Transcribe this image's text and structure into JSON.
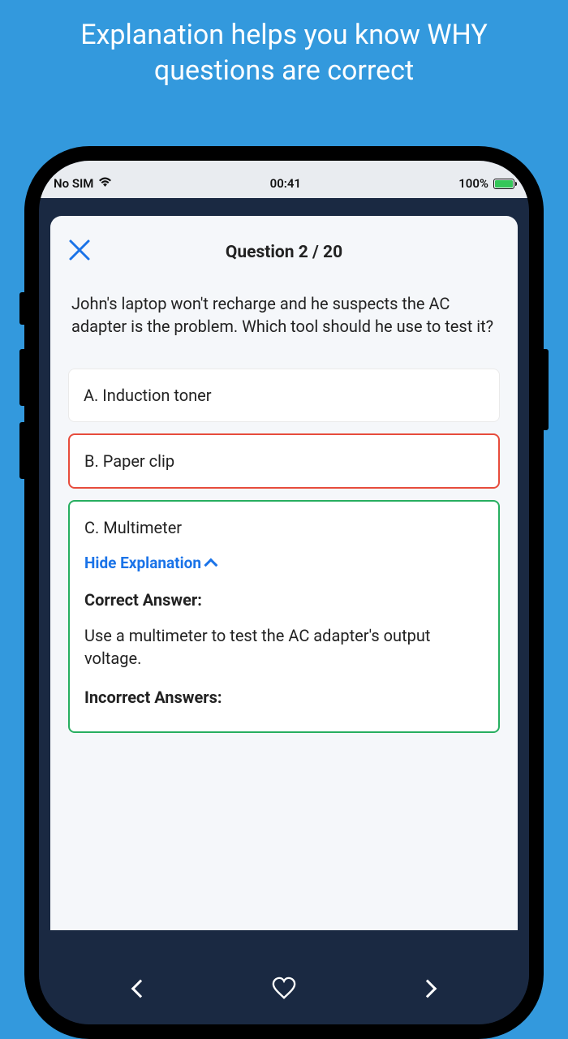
{
  "promo": {
    "headline": "Explanation helps you know WHY questions are correct"
  },
  "statusBar": {
    "carrier": "No SIM",
    "time": "00:41",
    "battery": "100%"
  },
  "quiz": {
    "header": "Question 2 / 20",
    "question": "John's laptop won't recharge and he suspects the AC adapter is the problem. Which tool should he use to test it?",
    "answers": {
      "a": "A. Induction toner",
      "b": "B. Paper clip",
      "c": "C. Multimeter"
    },
    "hideExplanation": "Hide Explanation",
    "correctHeading": "Correct Answer:",
    "correctText": "Use a multimeter to test the AC adapter's output voltage.",
    "incorrectHeading": "Incorrect Answers:"
  }
}
